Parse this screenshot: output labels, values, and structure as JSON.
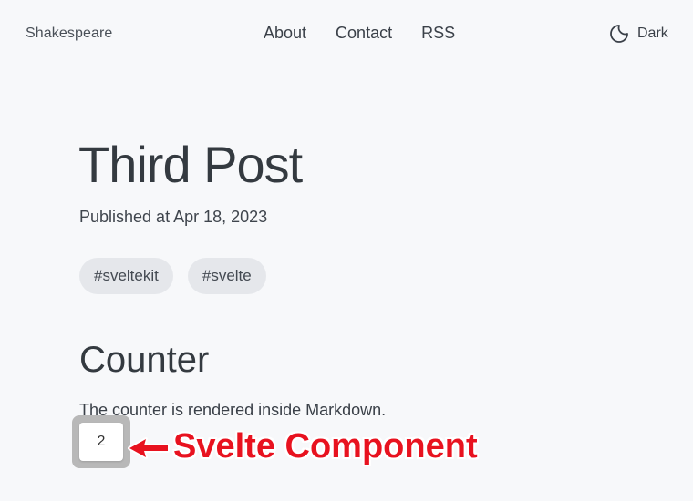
{
  "header": {
    "site_title": "Shakespeare",
    "nav": {
      "about": "About",
      "contact": "Contact",
      "rss": "RSS"
    },
    "theme_toggle_label": "Dark",
    "theme_icon": "moon-icon"
  },
  "post": {
    "title": "Third Post",
    "published": "Published at Apr 18, 2023",
    "tags": [
      "#sveltekit",
      "#svelte"
    ]
  },
  "section": {
    "heading": "Counter",
    "text": "The counter is rendered inside Markdown.",
    "counter_value": "2"
  },
  "annotation": {
    "label": "Svelte Component",
    "color": "#e8121f",
    "arrow_icon": "arrow-left-icon"
  },
  "colors": {
    "background": "#f7f8fa",
    "tag_background": "#e5e7eb",
    "text": "#343a40"
  }
}
